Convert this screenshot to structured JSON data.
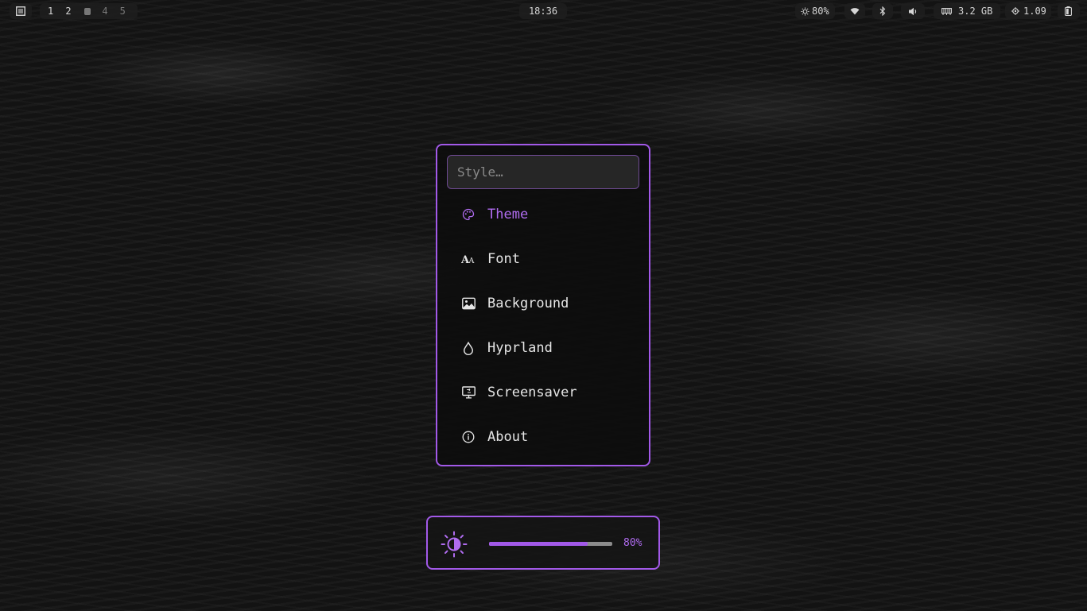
{
  "topbar": {
    "workspaces": [
      "1",
      "2",
      "4",
      "5"
    ],
    "clock": "18:36",
    "brightness": "80%",
    "memory": "3.2 GB",
    "cpu_load": "1.09",
    "icons": [
      "launcher-icon",
      "sun-icon",
      "wifi-icon",
      "bluetooth-icon",
      "volume-icon",
      "memory-icon",
      "cpu-icon",
      "battery-icon"
    ]
  },
  "menu": {
    "search_placeholder": "Style…",
    "items": [
      {
        "label": "Theme",
        "icon": "palette-icon",
        "active": true
      },
      {
        "label": "Font",
        "icon": "font-icon"
      },
      {
        "label": "Background",
        "icon": "image-icon"
      },
      {
        "label": "Hyprland",
        "icon": "drop-icon"
      },
      {
        "label": "Screensaver",
        "icon": "monitor-icon"
      },
      {
        "label": "About",
        "icon": "info-icon"
      }
    ]
  },
  "osd": {
    "label": "80%",
    "level": 0.8,
    "icon": "brightness-icon"
  },
  "colors": {
    "accent": "#a259e8",
    "accent_text": "#b06cf0",
    "panel_bg": "#0c0c0c",
    "bar_pill_bg": "#1e1e1e"
  }
}
